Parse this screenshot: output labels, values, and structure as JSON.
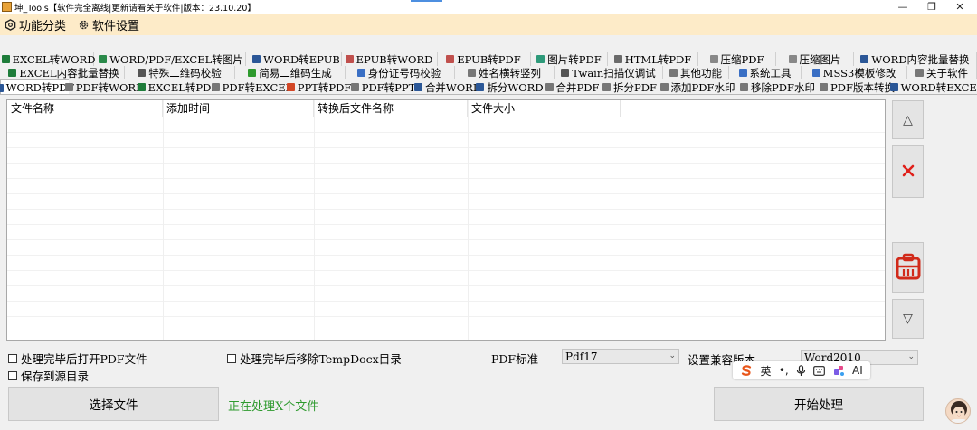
{
  "window": {
    "title": "坤_Tools【软件完全离线|更新请看关于软件|版本：23.10.20】",
    "controls": {
      "minimize": "—",
      "maximize": "❐",
      "close": "✕"
    }
  },
  "menubar": {
    "items": [
      {
        "label": "功能分类",
        "icon": "hexagon-icon"
      },
      {
        "label": "软件设置",
        "icon": "gear-icon"
      }
    ]
  },
  "tabs": {
    "row1": [
      {
        "label": "EXCEL转WORD",
        "color": "#1e7c3a"
      },
      {
        "label": "WORD/PDF/EXCEL转图片",
        "color": "#2a8a4a"
      },
      {
        "label": "WORD转EPUB",
        "color": "#2b5797"
      },
      {
        "label": "EPUB转WORD",
        "color": "#c0504d"
      },
      {
        "label": "EPUB转PDF",
        "color": "#c0504d"
      },
      {
        "label": "图片转PDF",
        "color": "#2e9a7a"
      },
      {
        "label": "HTML转PDF",
        "color": "#6a6a6a"
      },
      {
        "label": "压缩PDF",
        "color": "#888888"
      },
      {
        "label": "压缩图片",
        "color": "#888888"
      },
      {
        "label": "WORD内容批量替换",
        "color": "#2b5797"
      }
    ],
    "row2": [
      {
        "label": "EXCEL内容批量替换",
        "color": "#1e7c3a"
      },
      {
        "label": "特殊二维码校验",
        "color": "#555555"
      },
      {
        "label": "简易二维码生成",
        "color": "#2e9a2e"
      },
      {
        "label": "身份证号码校验",
        "color": "#3a6fc4"
      },
      {
        "label": "姓名横转竖列",
        "color": "#777777"
      },
      {
        "label": "Twain扫描仪调试",
        "color": "#555555"
      },
      {
        "label": "其他功能",
        "color": "#777777"
      },
      {
        "label": "系统工具",
        "color": "#3a6fc4"
      },
      {
        "label": "MSS3模板修改",
        "color": "#3a6fc4"
      },
      {
        "label": "关于软件",
        "color": "#777777"
      }
    ],
    "row3": [
      {
        "label": "WORD转PDF",
        "color": "#2b5797",
        "active": true
      },
      {
        "label": "PDF转WORD",
        "color": "#777777"
      },
      {
        "label": "EXCEL转PDF",
        "color": "#1e7c3a"
      },
      {
        "label": "PDF转EXCEL",
        "color": "#777777"
      },
      {
        "label": "PPT转PDF",
        "color": "#d24726"
      },
      {
        "label": "PDF转PPT",
        "color": "#777777"
      },
      {
        "label": "合并WORD",
        "color": "#2b5797"
      },
      {
        "label": "拆分WORD",
        "color": "#2b5797"
      },
      {
        "label": "合并PDF",
        "color": "#777777"
      },
      {
        "label": "拆分PDF",
        "color": "#777777"
      },
      {
        "label": "添加PDF水印",
        "color": "#777777"
      },
      {
        "label": "移除PDF水印",
        "color": "#777777"
      },
      {
        "label": "PDF版本转换",
        "color": "#777777"
      },
      {
        "label": "WORD转EXCEL",
        "color": "#2b5797"
      }
    ]
  },
  "table": {
    "columns": [
      "文件名称",
      "添加时间",
      "转换后文件名称",
      "文件大小"
    ],
    "rows": []
  },
  "side_buttons": {
    "up": {
      "label": "△",
      "icon": "triangle-up-icon"
    },
    "delete": {
      "label": "✕",
      "icon": "close-icon",
      "color": "#e0201a"
    },
    "clear": {
      "icon": "clipboard-icon",
      "color": "#d12a1a"
    },
    "down": {
      "label": "▽",
      "icon": "triangle-down-icon"
    }
  },
  "options": {
    "open_pdf_after": {
      "label": "处理完毕后打开PDF文件",
      "checked": false
    },
    "remove_tempdocx": {
      "label": "处理完毕后移除TempDocx目录",
      "checked": false
    },
    "save_to_source": {
      "label": "保存到源目录",
      "checked": false
    },
    "pdf_standard": {
      "label": "PDF标准",
      "value": "Pdf17"
    },
    "compat_version": {
      "label": "设置兼容版本",
      "value": "Word2010"
    }
  },
  "actions": {
    "select_files": "选择文件",
    "start": "开始处理"
  },
  "status": {
    "text": "正在处理X个文件",
    "color": "#2e9a2e"
  },
  "ime_toolbar": {
    "items": [
      {
        "label": "S",
        "icon": "sogou-logo-icon"
      },
      {
        "label": "英",
        "icon": "language-mode-icon"
      },
      {
        "label": "•,",
        "icon": "punctuation-icon"
      },
      {
        "label": "🎤",
        "icon": "microphone-icon"
      },
      {
        "label": "⌨",
        "icon": "keyboard-icon"
      },
      {
        "label": "✦",
        "icon": "skin-icon"
      },
      {
        "label": "AI",
        "icon": "ai-icon"
      }
    ]
  }
}
